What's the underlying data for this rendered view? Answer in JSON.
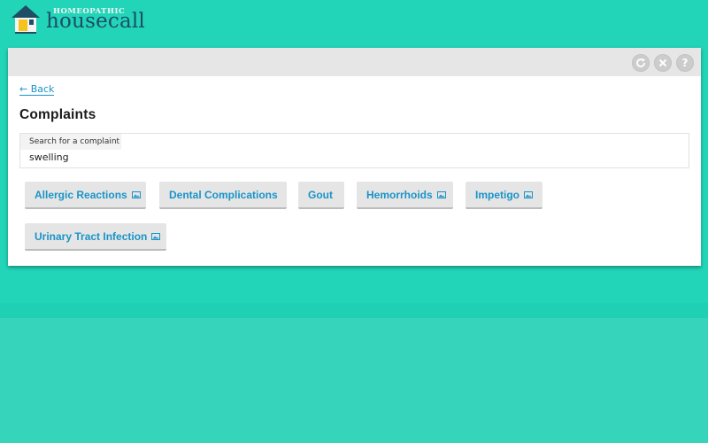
{
  "logo": {
    "small_text": "HOMEOPATHIC",
    "big_text": "housecall"
  },
  "header": {
    "refresh_icon": "refresh-icon",
    "close_icon": "close-icon",
    "help_icon": "help-icon",
    "help_glyph": "?"
  },
  "nav": {
    "back_label": "← Back"
  },
  "page": {
    "title": "Complaints"
  },
  "search": {
    "label": "Search for a complaint",
    "value": "swelling"
  },
  "complaints": [
    {
      "label": "Allergic Reactions",
      "has_image": true
    },
    {
      "label": "Dental Complications",
      "has_image": false
    },
    {
      "label": "Gout",
      "has_image": false
    },
    {
      "label": "Hemorrhoids",
      "has_image": true
    },
    {
      "label": "Impetigo",
      "has_image": true
    },
    {
      "label": "Urinary Tract Infection",
      "has_image": true
    }
  ],
  "colors": {
    "background": "#22d4b8",
    "accent": "#1a94c8",
    "logo_text": "#1d4e66"
  }
}
